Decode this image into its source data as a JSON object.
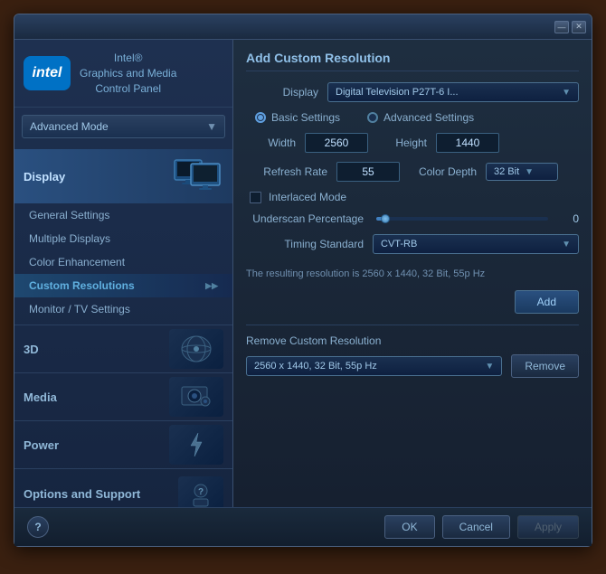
{
  "window": {
    "title": "Intel Graphics and Media Control Panel",
    "minimize_label": "—",
    "close_label": "✕"
  },
  "sidebar": {
    "intel_logo": "intel",
    "app_title_line1": "Intel®",
    "app_title_line2": "Graphics and Media",
    "app_title_line3": "Control Panel",
    "mode_selector_label": "Advanced Mode",
    "main_items": [
      {
        "id": "display",
        "label": "Display",
        "active": true
      }
    ],
    "sub_items": [
      {
        "id": "general-settings",
        "label": "General Settings",
        "active": false
      },
      {
        "id": "multiple-displays",
        "label": "Multiple Displays",
        "active": false
      },
      {
        "id": "color-enhancement",
        "label": "Color Enhancement",
        "active": false
      },
      {
        "id": "custom-resolutions",
        "label": "Custom Resolutions",
        "active": true
      },
      {
        "id": "monitor-settings",
        "label": "Monitor / TV Settings",
        "active": false
      }
    ],
    "big_items": [
      {
        "id": "3d",
        "label": "3D"
      },
      {
        "id": "media",
        "label": "Media"
      },
      {
        "id": "power",
        "label": "Power"
      }
    ],
    "options_label": "Options and Support"
  },
  "main": {
    "title": "Add Custom Resolution",
    "display_label": "Display",
    "display_value": "Digital Television P27T-6 I...",
    "basic_settings_label": "Basic Settings",
    "advanced_settings_label": "Advanced Settings",
    "width_label": "Width",
    "width_value": "2560",
    "height_label": "Height",
    "height_value": "1440",
    "refresh_label": "Refresh Rate",
    "refresh_value": "55",
    "color_depth_label": "Color Depth",
    "color_depth_value": "32 Bit",
    "interlaced_label": "Interlaced Mode",
    "underscan_label": "Underscan Percentage",
    "underscan_value": "0",
    "timing_label": "Timing Standard",
    "timing_value": "CVT-RB",
    "result_text": "The resulting resolution is 2560 x 1440, 32 Bit, 55p Hz",
    "add_button_label": "Add",
    "remove_section_title": "Remove Custom Resolution",
    "remove_dropdown_value": "2560 x 1440, 32 Bit, 55p Hz",
    "remove_button_label": "Remove"
  },
  "bottom_bar": {
    "help_label": "?",
    "ok_label": "OK",
    "cancel_label": "Cancel",
    "apply_label": "Apply"
  }
}
